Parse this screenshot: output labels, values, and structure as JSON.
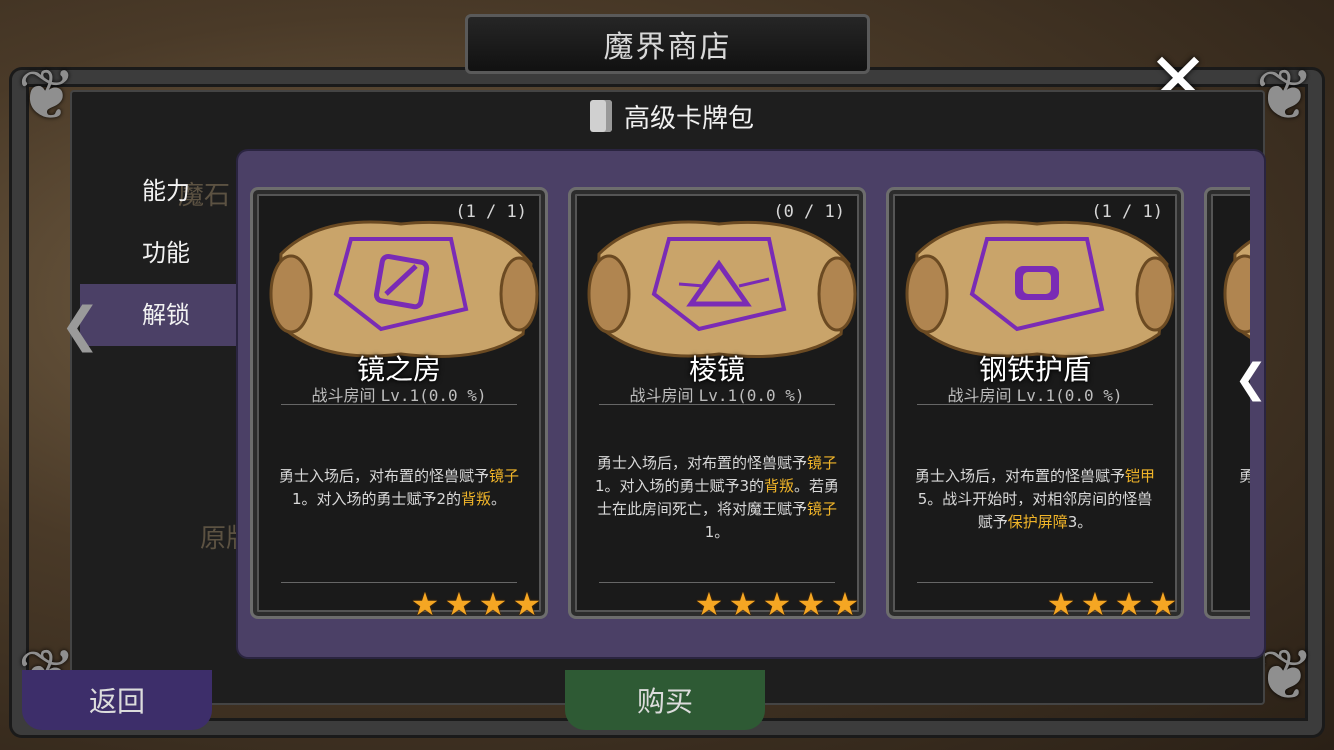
{
  "header": {
    "title": "魔界商店",
    "close_icon": "close-icon"
  },
  "pack": {
    "title": "高级卡牌包",
    "icon": "card-pack-icon"
  },
  "side_tabs": [
    {
      "label": "能力",
      "active": false
    },
    {
      "label": "功能",
      "active": false
    },
    {
      "label": "解锁",
      "active": true
    }
  ],
  "behind": {
    "text1": "魔石",
    "text2": "原版"
  },
  "footer": {
    "back_label": "返回",
    "buy_label": "购买"
  },
  "cards": [
    {
      "count": "(1 / 1)",
      "name": "镜之房",
      "type": "战斗房间",
      "level": "Lv.1(0.0 %)",
      "desc_parts": [
        {
          "t": "勇士入场后，对布置的怪兽赋予",
          "hl": false
        },
        {
          "t": "镜子",
          "hl": true
        },
        {
          "t": "1。对入场的勇士赋予2的",
          "hl": false
        },
        {
          "t": "背叛",
          "hl": true
        },
        {
          "t": "。",
          "hl": false
        }
      ],
      "stars": 4,
      "rune": "mirror-rune-icon"
    },
    {
      "count": "(0 / 1)",
      "name": "棱镜",
      "type": "战斗房间",
      "level": "Lv.1(0.0 %)",
      "desc_parts": [
        {
          "t": "勇士入场后，对布置的怪兽赋予",
          "hl": false
        },
        {
          "t": "镜子",
          "hl": true
        },
        {
          "t": "1。对入场的勇士赋予3的",
          "hl": false
        },
        {
          "t": "背叛",
          "hl": true
        },
        {
          "t": "。若勇士在此房间死亡，将对魔王赋予",
          "hl": false
        },
        {
          "t": "镜子",
          "hl": true
        },
        {
          "t": " 1。",
          "hl": false
        }
      ],
      "stars": 5,
      "rune": "prism-rune-icon"
    },
    {
      "count": "(1 / 1)",
      "name": "钢铁护盾",
      "type": "战斗房间",
      "level": "Lv.1(0.0 %)",
      "desc_parts": [
        {
          "t": "勇士入场后，对布置的怪兽赋予",
          "hl": false
        },
        {
          "t": "铠甲",
          "hl": true
        },
        {
          "t": "5。战斗开始时，对相邻房间的怪兽赋予",
          "hl": false
        },
        {
          "t": "保护屏障",
          "hl": true
        },
        {
          "t": "3。",
          "hl": false
        }
      ],
      "stars": 4,
      "rune": "shield-rune-icon"
    },
    {
      "count": "",
      "name": "",
      "type": "",
      "level": "",
      "desc_parts": [
        {
          "t": "勇士入场后，对布置的怪兽赋予",
          "hl": false
        }
      ],
      "stars": 0,
      "rune": "scroll-icon"
    }
  ],
  "colors": {
    "accent": "#4b4066",
    "highlight": "#f0b429",
    "star": "#f5a623",
    "rune": "#7a2bb5"
  }
}
